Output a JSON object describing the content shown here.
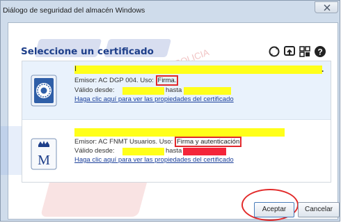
{
  "window": {
    "title": "Diálogo de seguridad del almacén Windows"
  },
  "header": {
    "title": "Seleccione un certificado"
  },
  "toolbar": {
    "icons": [
      "refresh-icon",
      "import-icon",
      "details-icon",
      "help-icon"
    ],
    "help_glyph": "?"
  },
  "watermark": {
    "text": "CIFICADO DE POLICIA",
    "left_text": "SINDIC",
    "right_text": "SIN"
  },
  "certificates": [
    {
      "name": "I",
      "name_tail": ".",
      "issuer_prefix": "Emisor: AC DGP 004. Uso:",
      "usage": "Firma.",
      "valid_from_label": "Válido desde:",
      "valid_to_label": "hasta",
      "link": "Haga clic aquí para ver las propiedades del certificado",
      "icon": "police-seal-icon"
    },
    {
      "issuer_prefix": "Emisor: AC FNMT Usuarios. Uso:",
      "usage": "Firma y autenticación",
      "valid_from_label": "Válido desde:",
      "valid_to_label": "hasta",
      "link": "Haga clic aquí para ver las propiedades del certificado",
      "icon": "fnmt-crown-m-icon",
      "icon_letter": "M"
    }
  ],
  "buttons": {
    "accept": "Aceptar",
    "cancel": "Cancelar"
  },
  "colors": {
    "highlight": "#ffff1a",
    "annotation": "#e0282c",
    "heading": "#1e3f8a",
    "link": "#1a3f9a"
  }
}
